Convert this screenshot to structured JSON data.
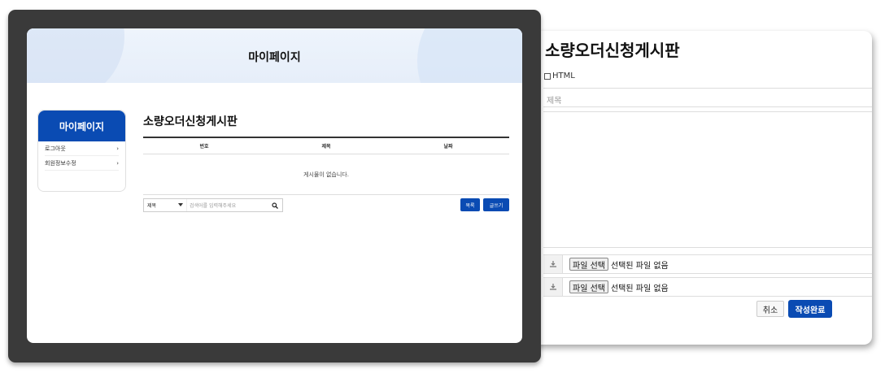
{
  "mypage": {
    "banner_title": "마이페이지",
    "sidebar": {
      "title": "마이페이지",
      "items": [
        {
          "label": "로그아웃",
          "arrow": "›"
        },
        {
          "label": "회원정보수정",
          "arrow": "›"
        }
      ]
    },
    "board": {
      "title": "소량오더신청게시판",
      "columns": [
        "번호",
        "제목",
        "날짜"
      ],
      "empty_message": "게시물이 없습니다.",
      "search": {
        "selected_option": "제목",
        "placeholder": "검색어를 입력해주세요"
      },
      "list_button": "목록",
      "write_button": "글쓰기"
    }
  },
  "write_form": {
    "title": "소량오더신청게시판",
    "html_label": "HTML",
    "subject_placeholder": "제목",
    "files": [
      {
        "button": "파일 선택",
        "status": "선택된 파일 없음"
      },
      {
        "button": "파일 선택",
        "status": "선택된 파일 없음"
      }
    ],
    "cancel_button": "취소",
    "submit_button": "작성완료"
  },
  "colors": {
    "accent": "#0a4bb3",
    "device_frame": "#3a3a3a",
    "banner_bg": "#e6eef9"
  }
}
